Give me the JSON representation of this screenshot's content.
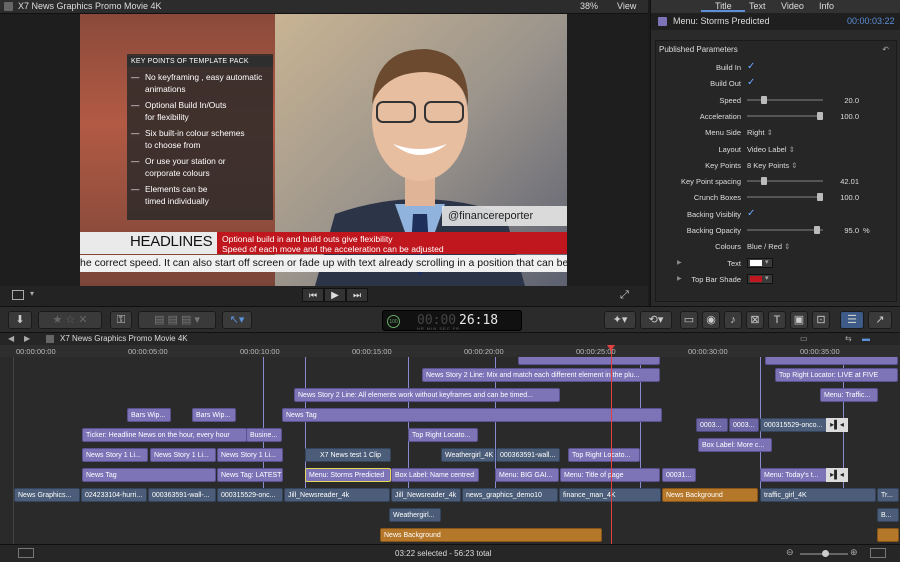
{
  "viewer": {
    "title": "X7 News Graphics Promo Movie 4K",
    "zoom": "38%",
    "view_menu": "View",
    "keypoints_title": "KEY POINTS OF TEMPLATE PACK",
    "keypoints": [
      [
        "No keyframing , easy automatic",
        "animations"
      ],
      [
        "Optional Build In/Outs",
        "for flexibility"
      ],
      [
        "Six built-in colour schemes",
        "to choose from"
      ],
      [
        "Or use your station or",
        "corporate colours"
      ],
      [
        "Elements can be",
        "timed individually"
      ]
    ],
    "handle": "@financereporter",
    "headline": "HEADLINES",
    "headline_lines": [
      "Optional build in and build outs give flexibility",
      "Speed of each move and the acceleration can be adjusted"
    ],
    "ticker": "he correct speed. It can also start off screen or fade up with text already scrolling in a position that can be"
  },
  "inspector": {
    "tabs": [
      "Title",
      "Text",
      "Video",
      "Info"
    ],
    "clip_name": "Menu: Storms Predicted",
    "duration": "00:00:03:22",
    "section": "Published Parameters",
    "params": [
      {
        "label": "Build In",
        "kind": "check"
      },
      {
        "label": "Build Out",
        "kind": "check"
      },
      {
        "label": "Speed",
        "kind": "slider",
        "value": "20.0",
        "level": 0.2
      },
      {
        "label": "Acceleration",
        "kind": "slider",
        "value": "100.0",
        "level": 1.0
      },
      {
        "label": "Menu Side",
        "kind": "popup",
        "value": "Right"
      },
      {
        "label": "Layout",
        "kind": "popup",
        "value": "Video Label"
      },
      {
        "label": "Key Points",
        "kind": "popup",
        "value": "8 Key Points"
      },
      {
        "label": "Key Point spacing",
        "kind": "slider",
        "value": "42.01",
        "level": 0.2
      },
      {
        "label": "Crunch Boxes",
        "kind": "slider",
        "value": "100.0",
        "level": 1.0
      },
      {
        "label": "Backing Visiblity",
        "kind": "check"
      },
      {
        "label": "Backing Opacity",
        "kind": "slider",
        "value": "95.0",
        "unit": "%",
        "level": 0.95
      },
      {
        "label": "Colours",
        "kind": "popup",
        "value": "Blue / Red"
      },
      {
        "label": "Text",
        "kind": "color",
        "color": "#ffffff"
      },
      {
        "label": "Top Bar Shade",
        "kind": "color",
        "color": "#c0161d"
      }
    ]
  },
  "toolbar": {
    "timecode": "26:18",
    "timecode_dim": "00:00",
    "timecode_units": [
      "HR",
      "MIN",
      "SEC",
      "FR"
    ],
    "timecode_percent": "100"
  },
  "timeline": {
    "project": "X7 News Graphics Promo Movie 4K",
    "ruler": [
      "00:00:00:00",
      "00:00:05:00",
      "00:00:10:00",
      "00:00:15:00",
      "00:00:20:00",
      "00:00:25:00",
      "00:00:30:00",
      "00:00:35:00"
    ],
    "status": "03:22 selected - 56:23 total",
    "clips": {
      "c1": "News Story 2 Line: Mix and match each different element in the plu...",
      "c2": "Top Right Locator: LIVE at FIVE",
      "c3": "News Story 2 Line: All elements work without keyframes and can be timed...",
      "c4": "Menu: Traffic...",
      "c5": "Bars Wip...",
      "c6": "Bars Wip...",
      "c7": "News Tag",
      "c8": "0003...",
      "c9": "0003...",
      "c10": "000315529-onco...",
      "c11": "Ticker: Headline News on the hour, every hour",
      "c12": "Busine...",
      "c13": "Top Right Locato...",
      "c14": "Box Label: More c...",
      "c15": "News Story 1 Li...",
      "c16": "News Story 1 Li...",
      "c17": "News Story 1 Li...",
      "c18": "X7 News test 1 Clip",
      "c19": "Weathergirl_4K",
      "c20": "000363591-wall...",
      "c21": "Top Right Locato...",
      "c22": "News Tag",
      "c23": "News Tag: LATEST",
      "c24": "Menu: Storms Predicted",
      "c25": "Box Label: Name centred",
      "c26": "Menu: BIG GAI...",
      "c27": "Menu: Title of page",
      "c28": "00031...",
      "c29": "Menu: Today's t...",
      "c30": "News Graphics...",
      "c31": "024233104-hurri...",
      "c32": "000363591-wall-...",
      "c33": "000315529-onc...",
      "c34": "Jill_Newsreader_4k",
      "c35": "Jill_Newsreader_4k",
      "c36": "news_graphics_demo10",
      "c37": "finance_man_4K",
      "c38": "News Background",
      "c39": "traffic_girl_4K",
      "c40": "Tr...",
      "c41": "Weathergirl...",
      "c42": "News Background",
      "c43": "B..."
    }
  },
  "colors": {
    "accent": "#5b8fd6",
    "playhead": "#e04040",
    "title_clip": "#7d74b8",
    "video_clip": "#4b5d78",
    "audio_clip": "#b5772a"
  }
}
